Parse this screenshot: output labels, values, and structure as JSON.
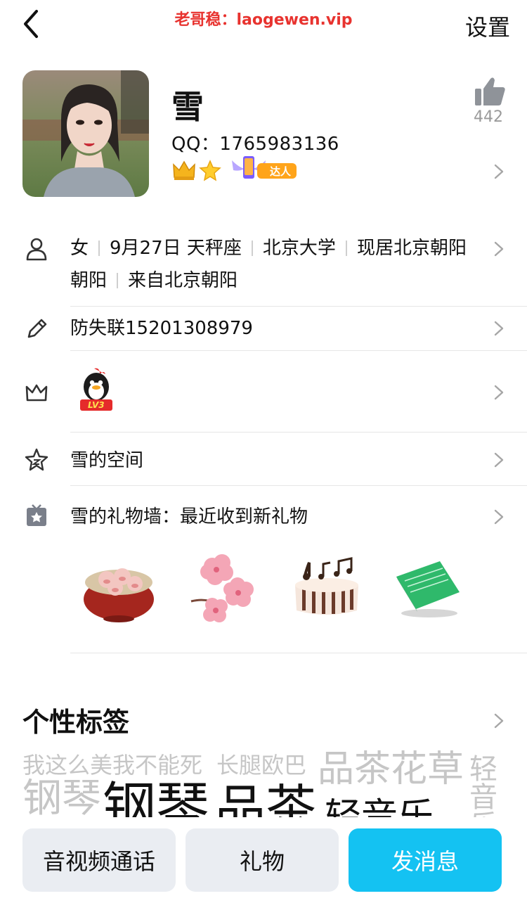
{
  "watermark": "老哥稳：laogewen.vip",
  "header": {
    "settings_label": "设置"
  },
  "profile": {
    "name": "雪",
    "qq": "QQ：1765983136",
    "likes": "442",
    "badge_label": "达人"
  },
  "info": {
    "gender": "女",
    "birthday": "9月27日 天秤座",
    "school": "北京大学",
    "location": "现居北京朝阳",
    "hometown": "来自北京朝阳",
    "signature": "防失联15201308979",
    "vip_level": "LV3",
    "space": "雪的空间",
    "gift_wall": "雪的礼物墙：最近收到新礼物"
  },
  "gifts": [
    "pig-bowl-gift",
    "sakura-gift",
    "music-cake-gift",
    "birthday-card-gift"
  ],
  "tags": {
    "title": "个性标签",
    "items": [
      "我这么美我不能死",
      "长腿欧巴",
      "品茶花草",
      "轻音乐",
      "钢琴",
      "钢琴",
      "品茶",
      "轻音乐"
    ]
  },
  "bottom_bar": {
    "call_label": "音视频通话",
    "gift_label": "礼物",
    "message_label": "发消息"
  },
  "colors": {
    "accent": "#14c2f2",
    "watermark": "#e8332f",
    "secondary_button": "#eaedf2"
  }
}
